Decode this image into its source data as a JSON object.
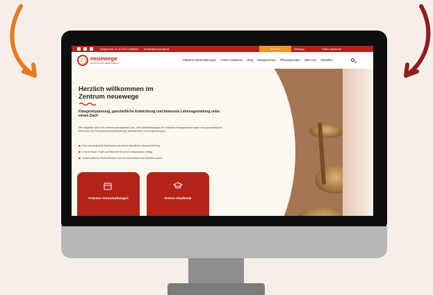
{
  "site": {
    "topbar": {
      "address": "Ziegelstraße 32, A-8720 Knittelfeld",
      "email": "kontakt@neuewege.at",
      "links": [
        "Zentrum",
        "Webshop",
        "Online-Akademie"
      ]
    },
    "logo": {
      "name": "neuewege",
      "tagline": "ZENTRUM FÜR LEBENSWEGE"
    },
    "menu": [
      "Präsenz-Veranstaltungen",
      "Online Akademie",
      "Blog",
      "Klangzentrum",
      "Öffnungszeiten",
      "Über uns",
      "Aktuelles"
    ],
    "hero": {
      "title_line1": "Herzlich willkommen im",
      "title_line2": "Zentrum neuewege",
      "lead": "Klangentspannung, ganzheitliche Entwicklung und bewusste Lebensgestaltung unter einem Dach",
      "paragraph": "Wir begleiten dich mit unseren anerkannten Aus- und Weiterbildungen für heilsame Klanganwendungen und ganzheitlichen Methoden für Persönlichkeitsentwicklung, Achtsamkeit und Entspannung in",
      "bullets": [
        "dein persönliches Wachstum und deine berufliche Neuausrichtung",
        "innere Ruhe, Kraft und Klarheit für einen entspannten Alltag",
        "Ganzheitliches Wohlbefinden und ein bewusstes und erfülltes Leben"
      ]
    },
    "cards": [
      {
        "label": "Präsenz-Veranstaltungen",
        "icon": "calendar-icon"
      },
      {
        "label": "Online-Akademie",
        "icon": "graduation-cap-icon"
      }
    ]
  },
  "colors": {
    "brand_red": "#b42318",
    "accent_orange": "#f29424",
    "left_arrow": "#e87a22",
    "right_arrow": "#8e1f22"
  }
}
